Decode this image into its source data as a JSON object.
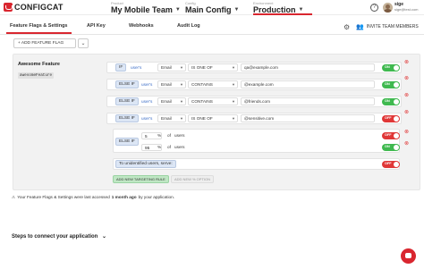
{
  "header": {
    "logo_text": "CONFIGCAT",
    "product": {
      "label": "Product",
      "value": "My Mobile Team"
    },
    "config": {
      "label": "Config",
      "value": "Main Config"
    },
    "environment": {
      "label": "Environment",
      "value": "Production"
    },
    "help_glyph": "?",
    "user": {
      "name": "sige",
      "email": "sige@test.com"
    }
  },
  "tabs": [
    {
      "label": "Feature Flags & Settings",
      "active": true
    },
    {
      "label": "API Key"
    },
    {
      "label": "Webhooks"
    },
    {
      "label": "Audit Log"
    }
  ],
  "invite_label": "INVITE TEAM MEMBERS",
  "add_flag_label": "+ ADD FEATURE FLAG",
  "flag": {
    "name": "Awesome Feature",
    "key": "awesomeFeature"
  },
  "rules": [
    {
      "kind": "IF",
      "target": "user's",
      "attribute": "Email",
      "comparator": "IS ONE OF",
      "value": "qa@example.com",
      "serve": "ON"
    },
    {
      "kind": "ELSE IF",
      "target": "user's",
      "attribute": "Email",
      "comparator": "CONTAINS",
      "value": "@example.com",
      "serve": "ON"
    },
    {
      "kind": "ELSE IF",
      "target": "user's",
      "attribute": "Email",
      "comparator": "CONTAINS",
      "value": "@friends.com",
      "serve": "ON"
    },
    {
      "kind": "ELSE IF",
      "target": "user's",
      "attribute": "Email",
      "comparator": "IS ONE OF",
      "value": "@sensitive.com",
      "serve": "OFF"
    }
  ],
  "percentage": {
    "kind": "ELSE IF",
    "rows": [
      {
        "value": "5",
        "unit": "%",
        "of": "of",
        "target": "users",
        "serve": "OFF"
      },
      {
        "value": "95",
        "unit": "%",
        "of": "of",
        "target": "users",
        "serve": "ON"
      }
    ]
  },
  "default_rule": {
    "label": "To unidentified users, serve:",
    "serve": "OFF"
  },
  "add_targeting_label": "ADD NEW TARGETING RULE",
  "add_option_label": "ADD NEW % OPTION",
  "note": {
    "prefix": "Your Feature Flags & Settings were last accessed",
    "emphasis": "1 month ago",
    "suffix": "by your application."
  },
  "steps_label": "Steps to connect your application",
  "colors": {
    "brand": "#d9262f",
    "on": "#3fb94f",
    "off": "#e03737",
    "link": "#3a6cc7"
  }
}
